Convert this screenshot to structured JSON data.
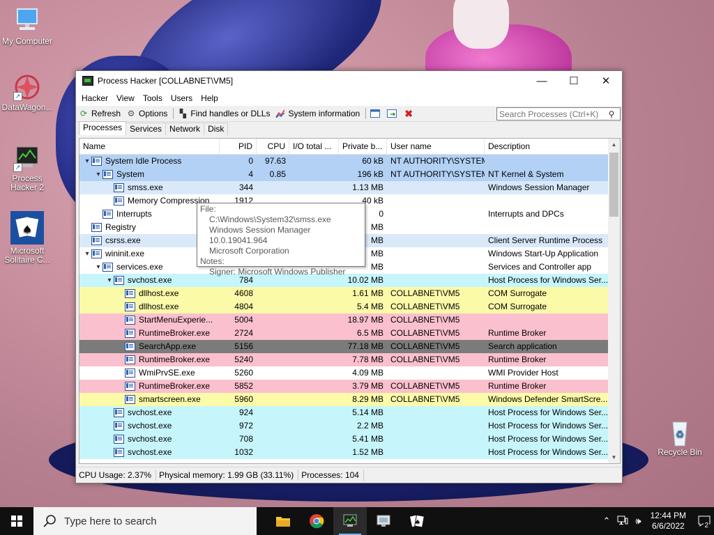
{
  "desktop": {
    "icons": [
      {
        "label": "My Computer",
        "icon": "computer-icon"
      },
      {
        "label": "DataWagon...",
        "icon": "datawagon-icon"
      },
      {
        "label": "Process Hacker 2",
        "icon": "process-hacker-icon"
      },
      {
        "label": "Microsoft Solitaire C...",
        "icon": "solitaire-icon"
      },
      {
        "label": "Recycle Bin",
        "icon": "recycle-bin-icon"
      }
    ]
  },
  "window": {
    "title": "Process Hacker [COLLABNET\\VM5]",
    "controls": {
      "minimize": "—",
      "maximize": "☐",
      "close": "✕"
    }
  },
  "menu": [
    "Hacker",
    "View",
    "Tools",
    "Users",
    "Help"
  ],
  "toolbar": {
    "refresh": "Refresh",
    "options": "Options",
    "find_handles": "Find handles or DLLs",
    "system_info": "System information",
    "search_placeholder": "Search Processes (Ctrl+K)"
  },
  "tabs": [
    "Processes",
    "Services",
    "Network",
    "Disk"
  ],
  "columns": [
    "Name",
    "PID",
    "CPU",
    "I/O total ...",
    "Private b...",
    "User name",
    "Description"
  ],
  "rows": [
    {
      "name": "System Idle Process",
      "indent": 0,
      "exp": "▾",
      "pid": "0",
      "cpu": "97.63",
      "io": "",
      "priv": "60 kB",
      "user": "NT AUTHORITY\\SYSTEM",
      "desc": "",
      "bg": "#b3d1f5"
    },
    {
      "name": "System",
      "indent": 1,
      "exp": "▾",
      "pid": "4",
      "cpu": "0.85",
      "io": "",
      "priv": "196 kB",
      "user": "NT AUTHORITY\\SYSTEM",
      "desc": "NT Kernel & System",
      "bg": "#b3d1f5"
    },
    {
      "name": "smss.exe",
      "indent": 2,
      "exp": "",
      "pid": "344",
      "cpu": "",
      "io": "",
      "priv": "1.13 MB",
      "user": "",
      "desc": "Windows Session Manager",
      "bg": "#d9e9f9"
    },
    {
      "name": "Memory Compression",
      "indent": 2,
      "exp": "",
      "pid": "1912",
      "cpu": "",
      "io": "",
      "priv": "40 kB",
      "user": "",
      "desc": "",
      "bg": "#ffffff"
    },
    {
      "name": "Interrupts",
      "indent": 1,
      "exp": "",
      "pid": "",
      "cpu": "",
      "io": "",
      "priv": "0",
      "user": "",
      "desc": "Interrupts and DPCs",
      "bg": "#ffffff"
    },
    {
      "name": "Registry",
      "indent": 0,
      "exp": "",
      "pid": "",
      "cpu": "",
      "io": "",
      "priv": "MB",
      "user": "",
      "desc": "",
      "bg": "#ffffff"
    },
    {
      "name": "csrss.exe",
      "indent": 0,
      "exp": "",
      "pid": "",
      "cpu": "",
      "io": "",
      "priv": "MB",
      "user": "",
      "desc": "Client Server Runtime Process",
      "bg": "#d9e9f9"
    },
    {
      "name": "wininit.exe",
      "indent": 0,
      "exp": "▾",
      "pid": "",
      "cpu": "",
      "io": "",
      "priv": "MB",
      "user": "",
      "desc": "Windows Start-Up Application",
      "bg": "#ffffff"
    },
    {
      "name": "services.exe",
      "indent": 1,
      "exp": "▾",
      "pid": "",
      "cpu": "",
      "io": "",
      "priv": "MB",
      "user": "",
      "desc": "Services and Controller app",
      "bg": "#ffffff"
    },
    {
      "name": "svchost.exe",
      "indent": 2,
      "exp": "▾",
      "pid": "784",
      "cpu": "",
      "io": "",
      "priv": "10.02 MB",
      "user": "",
      "desc": "Host Process for Windows Ser...",
      "bg": "#c6f5fb"
    },
    {
      "name": "dllhost.exe",
      "indent": 3,
      "exp": "",
      "pid": "4608",
      "cpu": "",
      "io": "",
      "priv": "1.61 MB",
      "user": "COLLABNET\\VM5",
      "desc": "COM Surrogate",
      "bg": "#fbfaa8"
    },
    {
      "name": "dllhost.exe",
      "indent": 3,
      "exp": "",
      "pid": "4804",
      "cpu": "",
      "io": "",
      "priv": "5.4 MB",
      "user": "COLLABNET\\VM5",
      "desc": "COM Surrogate",
      "bg": "#fbfaa8"
    },
    {
      "name": "StartMenuExperie...",
      "indent": 3,
      "exp": "",
      "pid": "5004",
      "cpu": "",
      "io": "",
      "priv": "18.97 MB",
      "user": "COLLABNET\\VM5",
      "desc": "",
      "bg": "#fbc0cd"
    },
    {
      "name": "RuntimeBroker.exe",
      "indent": 3,
      "exp": "",
      "pid": "2724",
      "cpu": "",
      "io": "",
      "priv": "6.5 MB",
      "user": "COLLABNET\\VM5",
      "desc": "Runtime Broker",
      "bg": "#fbc0cd"
    },
    {
      "name": "SearchApp.exe",
      "indent": 3,
      "exp": "",
      "pid": "5156",
      "cpu": "",
      "io": "",
      "priv": "77.18 MB",
      "user": "COLLABNET\\VM5",
      "desc": "Search application",
      "bg": "#7b7b7b"
    },
    {
      "name": "RuntimeBroker.exe",
      "indent": 3,
      "exp": "",
      "pid": "5240",
      "cpu": "",
      "io": "",
      "priv": "7.78 MB",
      "user": "COLLABNET\\VM5",
      "desc": "Runtime Broker",
      "bg": "#fbc0cd"
    },
    {
      "name": "WmiPrvSE.exe",
      "indent": 3,
      "exp": "",
      "pid": "5260",
      "cpu": "",
      "io": "",
      "priv": "4.09 MB",
      "user": "",
      "desc": "WMI Provider Host",
      "bg": "#ffffff"
    },
    {
      "name": "RuntimeBroker.exe",
      "indent": 3,
      "exp": "",
      "pid": "5852",
      "cpu": "",
      "io": "",
      "priv": "3.79 MB",
      "user": "COLLABNET\\VM5",
      "desc": "Runtime Broker",
      "bg": "#fbc0cd"
    },
    {
      "name": "smartscreen.exe",
      "indent": 3,
      "exp": "",
      "pid": "5960",
      "cpu": "",
      "io": "",
      "priv": "8.29 MB",
      "user": "COLLABNET\\VM5",
      "desc": "Windows Defender SmartScre...",
      "bg": "#fbfaa8"
    },
    {
      "name": "svchost.exe",
      "indent": 2,
      "exp": "",
      "pid": "924",
      "cpu": "",
      "io": "",
      "priv": "5.14 MB",
      "user": "",
      "desc": "Host Process for Windows Ser...",
      "bg": "#c6f5fb"
    },
    {
      "name": "svchost.exe",
      "indent": 2,
      "exp": "",
      "pid": "972",
      "cpu": "",
      "io": "",
      "priv": "2.2 MB",
      "user": "",
      "desc": "Host Process for Windows Ser...",
      "bg": "#c6f5fb"
    },
    {
      "name": "svchost.exe",
      "indent": 2,
      "exp": "",
      "pid": "708",
      "cpu": "",
      "io": "",
      "priv": "5.41 MB",
      "user": "",
      "desc": "Host Process for Windows Ser...",
      "bg": "#c6f5fb"
    },
    {
      "name": "svchost.exe",
      "indent": 2,
      "exp": "",
      "pid": "1032",
      "cpu": "",
      "io": "",
      "priv": "1.52 MB",
      "user": "",
      "desc": "Host Process for Windows Ser...",
      "bg": "#c6f5fb"
    }
  ],
  "tooltip": {
    "file_label": "File:",
    "path": "C:\\Windows\\System32\\smss.exe",
    "version": "Windows Session Manager 10.0.19041.964",
    "company": "Microsoft Corporation",
    "notes_label": "Notes:",
    "signer": "Signer: Microsoft Windows Publisher"
  },
  "status": {
    "cpu": "CPU Usage: 2.37%",
    "memory": "Physical memory: 1.99 GB (33.11%)",
    "processes": "Processes: 104"
  },
  "taskbar": {
    "search_placeholder": "Type here to search",
    "time": "12:44 PM",
    "date": "6/6/2022",
    "notifications": "2"
  }
}
